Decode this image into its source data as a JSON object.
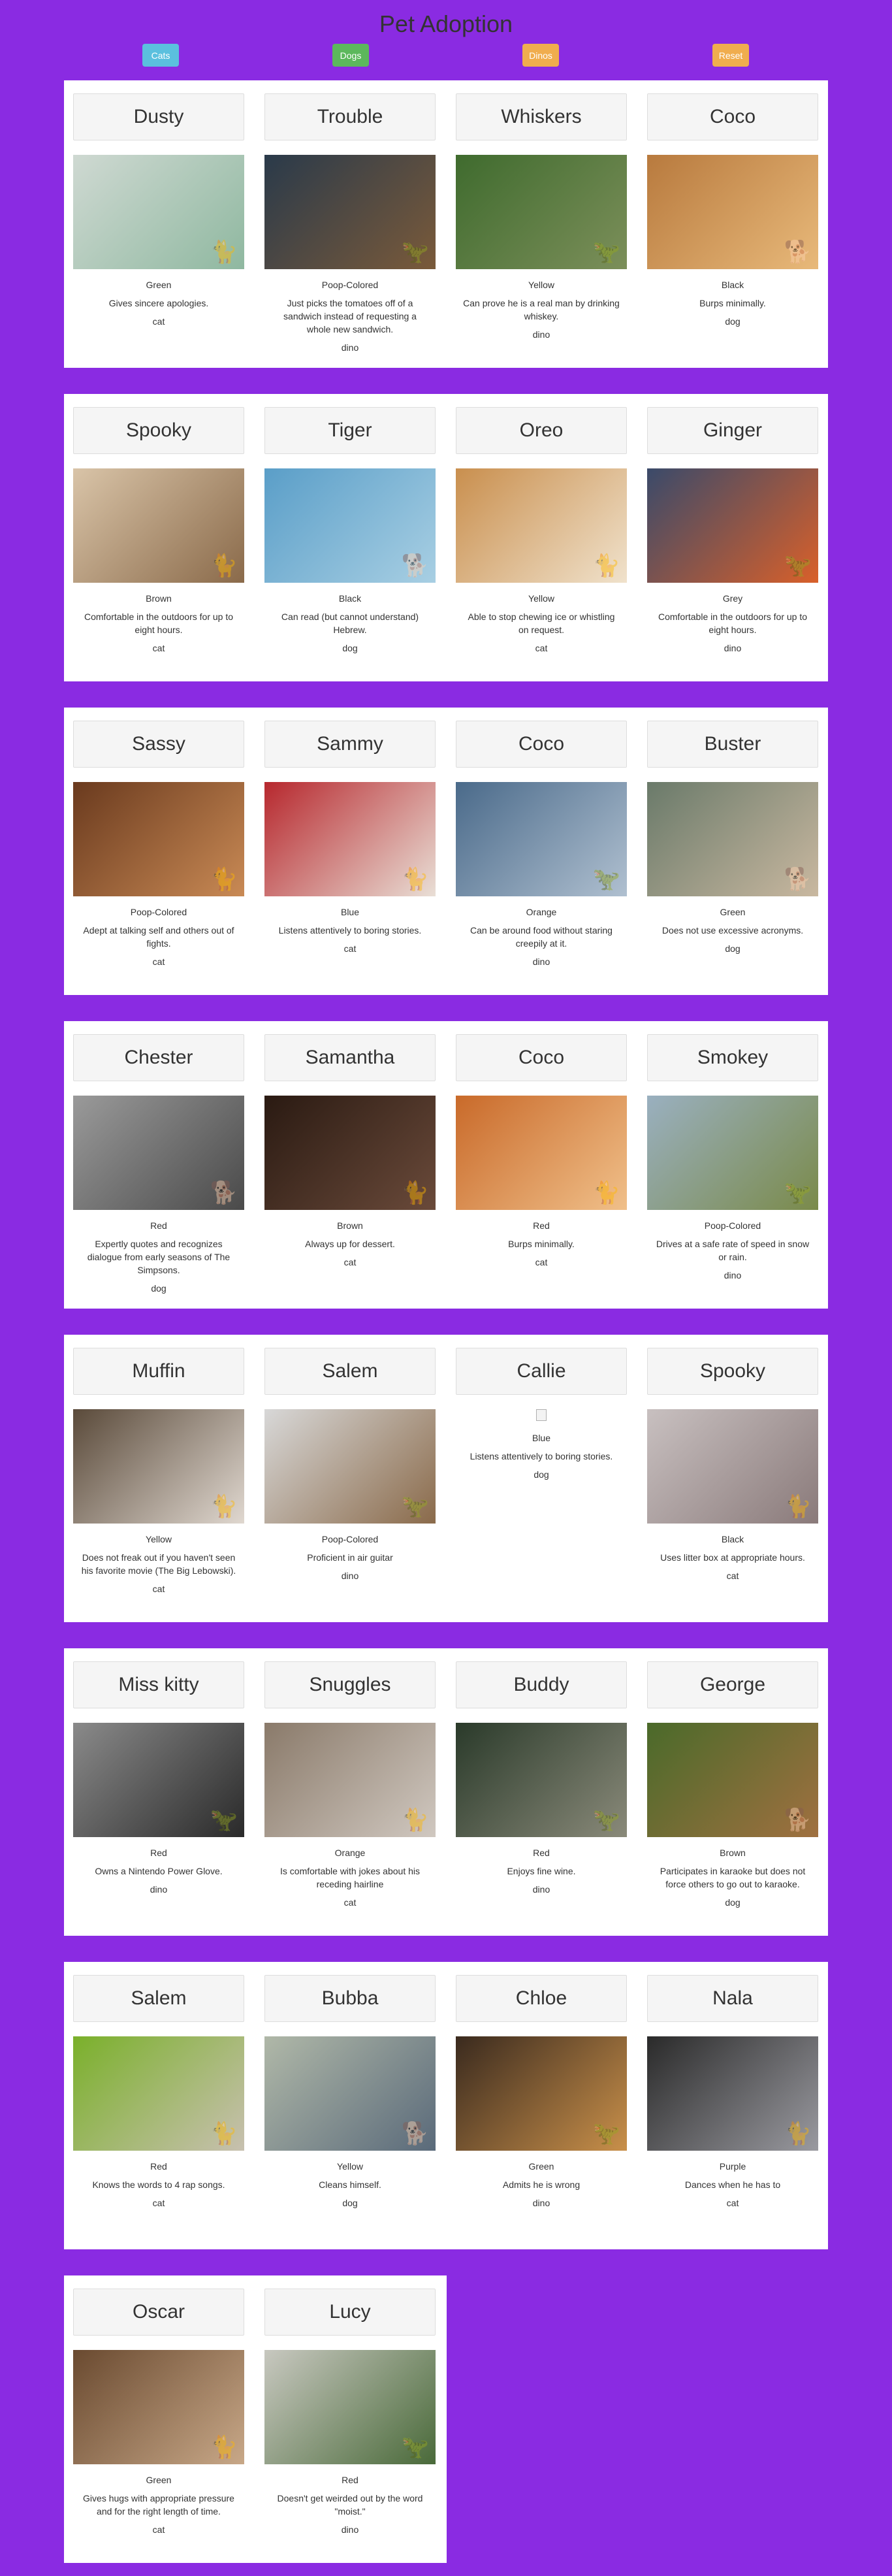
{
  "page": {
    "title": "Pet Adoption",
    "background": "#8a2be2"
  },
  "filters": [
    {
      "label": "Cats",
      "color": "#5bc0de"
    },
    {
      "label": "Dogs",
      "color": "#5cb85c"
    },
    {
      "label": "Dinos",
      "color": "#f0ad4e"
    },
    {
      "label": "Reset",
      "color": "#f0ad4e"
    }
  ],
  "rows": [
    [
      {
        "name": "Dusty",
        "color": "Green",
        "trait": "Gives sincere apologies.",
        "type": "cat",
        "image": true,
        "bg": [
          "#cfd9d2",
          "#8fb8a0"
        ]
      },
      {
        "name": "Trouble",
        "color": "Poop-Colored",
        "trait": "Just picks the tomatoes off of a sandwich instead of requesting a whole new sandwich.",
        "type": "dino",
        "image": true,
        "bg": [
          "#2a3a4a",
          "#7a5a3a"
        ]
      },
      {
        "name": "Whiskers",
        "color": "Yellow",
        "trait": "Can prove he is a real man by drinking whiskey.",
        "type": "dino",
        "image": true,
        "bg": [
          "#3f6b2e",
          "#7c8f5a"
        ]
      },
      {
        "name": "Coco",
        "color": "Black",
        "trait": "Burps minimally.",
        "type": "dog",
        "image": true,
        "bg": [
          "#b87a3e",
          "#e8b97a"
        ]
      }
    ],
    [
      {
        "name": "Spooky",
        "color": "Brown",
        "trait": "Comfortable in the outdoors for up to eight hours.",
        "type": "cat",
        "image": true,
        "bg": [
          "#d9c4a8",
          "#8a6a4a"
        ]
      },
      {
        "name": "Tiger",
        "color": "Black",
        "trait": "Can read (but cannot understand) Hebrew.",
        "type": "dog",
        "image": true,
        "bg": [
          "#5a9ec8",
          "#a8cfe3"
        ]
      },
      {
        "name": "Oreo",
        "color": "Yellow",
        "trait": "Able to stop chewing ice or whistling on request.",
        "type": "cat",
        "image": true,
        "bg": [
          "#c98f4e",
          "#f0e2cc"
        ]
      },
      {
        "name": "Ginger",
        "color": "Grey",
        "trait": "Comfortable in the outdoors for up to eight hours.",
        "type": "dino",
        "image": true,
        "bg": [
          "#3a4a6a",
          "#d9602a"
        ]
      }
    ],
    [
      {
        "name": "Sassy",
        "color": "Poop-Colored",
        "trait": "Adept at talking self and others out of fights.",
        "type": "cat",
        "image": true,
        "bg": [
          "#6a3a1e",
          "#c98a55"
        ]
      },
      {
        "name": "Sammy",
        "color": "Blue",
        "trait": "Listens attentively to boring stories.",
        "type": "cat",
        "image": true,
        "bg": [
          "#b7282e",
          "#e9dfd6"
        ]
      },
      {
        "name": "Coco",
        "color": "Orange",
        "trait": "Can be around food without staring creepily at it.",
        "type": "dino",
        "image": true,
        "bg": [
          "#4a6a8a",
          "#b0c0d0"
        ]
      },
      {
        "name": "Buster",
        "color": "Green",
        "trait": "Does not use excessive acronyms.",
        "type": "dog",
        "image": true,
        "bg": [
          "#6a7a6a",
          "#c9b8a0"
        ]
      }
    ],
    [
      {
        "name": "Chester",
        "color": "Red",
        "trait": "Expertly quotes and recognizes dialogue from early seasons of The Simpsons.",
        "type": "dog",
        "image": true,
        "bg": [
          "#9a9a9a",
          "#4a4a4a"
        ]
      },
      {
        "name": "Samantha",
        "color": "Brown",
        "trait": "Always up for dessert.",
        "type": "cat",
        "image": true,
        "bg": [
          "#2a1a12",
          "#6a4a3a"
        ]
      },
      {
        "name": "Coco",
        "color": "Red",
        "trait": "Burps minimally.",
        "type": "cat",
        "image": true,
        "bg": [
          "#c96a2a",
          "#f0c08a"
        ]
      },
      {
        "name": "Smokey",
        "color": "Poop-Colored",
        "trait": "Drives at a safe rate of speed in snow or rain.",
        "type": "dino",
        "image": true,
        "bg": [
          "#9ab0c0",
          "#7a8a4a"
        ]
      }
    ],
    [
      {
        "name": "Muffin",
        "color": "Yellow",
        "trait": "Does not freak out if you haven't seen his favorite movie (The Big Lebowski).",
        "type": "cat",
        "image": true,
        "bg": [
          "#5a4a3a",
          "#e0d8d0"
        ]
      },
      {
        "name": "Salem",
        "color": "Poop-Colored",
        "trait": "Proficient in air guitar",
        "type": "dino",
        "image": true,
        "bg": [
          "#d8d8d8",
          "#8a6a4a"
        ]
      },
      {
        "name": "Callie",
        "color": "Blue",
        "trait": "Listens attentively to boring stories.",
        "type": "dog",
        "image": false,
        "bg": [
          "#ffffff",
          "#ffffff"
        ]
      },
      {
        "name": "Spooky",
        "color": "Black",
        "trait": "Uses litter box at appropriate hours.",
        "type": "cat",
        "image": true,
        "bg": [
          "#c8c0c0",
          "#8a7a7a"
        ]
      }
    ],
    [
      {
        "name": "Miss kitty",
        "color": "Red",
        "trait": "Owns a Nintendo Power Glove.",
        "type": "dino",
        "image": true,
        "bg": [
          "#8a8a8a",
          "#2a2a2a"
        ]
      },
      {
        "name": "Snuggles",
        "color": "Orange",
        "trait": "Is comfortable with jokes about his receding hairline",
        "type": "cat",
        "image": true,
        "bg": [
          "#8a7a6a",
          "#d0c8c0"
        ]
      },
      {
        "name": "Buddy",
        "color": "Red",
        "trait": "Enjoys fine wine.",
        "type": "dino",
        "image": true,
        "bg": [
          "#2a3a2a",
          "#8a8a7a"
        ]
      },
      {
        "name": "George",
        "color": "Brown",
        "trait": "Participates in karaoke but does not force others to go out to karaoke.",
        "type": "dog",
        "image": true,
        "bg": [
          "#4a6a2a",
          "#a07040"
        ]
      }
    ],
    [
      {
        "name": "Salem",
        "color": "Red",
        "trait": "Knows the words to 4 rap songs.",
        "type": "cat",
        "image": true,
        "bg": [
          "#7ab02a",
          "#c8c0b0"
        ]
      },
      {
        "name": "Bubba",
        "color": "Yellow",
        "trait": "Cleans himself.",
        "type": "dog",
        "image": true,
        "bg": [
          "#b0b8a8",
          "#5a6a7a"
        ]
      },
      {
        "name": "Chloe",
        "color": "Green",
        "trait": "Admits he is wrong",
        "type": "dino",
        "image": true,
        "bg": [
          "#3a2a1e",
          "#c9904a"
        ]
      },
      {
        "name": "Nala",
        "color": "Purple",
        "trait": "Dances when he has to",
        "type": "cat",
        "image": true,
        "bg": [
          "#2a2a2a",
          "#9a9aa0"
        ]
      }
    ],
    [
      {
        "name": "Oscar",
        "color": "Green",
        "trait": "Gives hugs with appropriate pressure and for the right length of time.",
        "type": "cat",
        "image": true,
        "bg": [
          "#6a4a30",
          "#c8a888"
        ]
      },
      {
        "name": "Lucy",
        "color": "Red",
        "trait": "Doesn't get weirded out by the word \"moist.\"",
        "type": "dino",
        "image": true,
        "bg": [
          "#c8c8c0",
          "#4a6a3a"
        ]
      }
    ]
  ]
}
